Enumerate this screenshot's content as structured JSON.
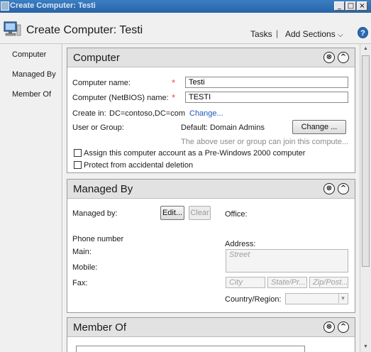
{
  "window": {
    "title": "Create Computer: Testi"
  },
  "header": {
    "title": "Create Computer: Testi",
    "tasks_label": "Tasks",
    "separator": "|",
    "add_sections_label": "Add Sections",
    "help_label": "?"
  },
  "nav": {
    "items": [
      {
        "label": "Computer"
      },
      {
        "label": "Managed By"
      },
      {
        "label": "Member Of"
      }
    ]
  },
  "computer": {
    "title": "Computer",
    "name_label": "Computer name:",
    "name_value": "Testi",
    "netbios_label": "Computer (NetBIOS) name:",
    "netbios_value": "TESTI",
    "createin_label": "Create in:",
    "createin_value": "DC=contoso,DC=com",
    "change_link": "Change...",
    "usergroup_label": "User or Group:",
    "usergroup_value": "Default: Domain Admins",
    "change_button": "Change ...",
    "usergroup_note": "The above user or group can join this compute...",
    "pre2000_label": "Assign this computer account as a Pre-Windows 2000 computer",
    "protect_label": "Protect from accidental deletion",
    "required_mark": "*"
  },
  "managed_by": {
    "title": "Managed By",
    "managedby_label": "Managed by:",
    "edit_button": "Edit...",
    "clear_button": "Clear",
    "office_label": "Office:",
    "phone_label": "Phone number",
    "main_label": "Main:",
    "mobile_label": "Mobile:",
    "fax_label": "Fax:",
    "address_label": "Address:",
    "street_placeholder": "Street",
    "city_placeholder": "City",
    "state_placeholder": "State/Pr...",
    "zip_placeholder": "Zip/Post...",
    "country_label": "Country/Region:"
  },
  "member_of": {
    "title": "Member Of"
  },
  "icons": {
    "close": "⊗",
    "collapse": "^",
    "dropdown": "▾",
    "scroll_up": "▲",
    "scroll_down": "▼"
  }
}
